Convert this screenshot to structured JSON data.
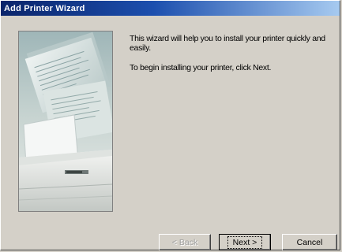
{
  "window": {
    "title": "Add Printer Wizard"
  },
  "content": {
    "intro_line": "This wizard will help you to install your printer quickly and easily.",
    "begin_line": "To begin installing your printer, click Next."
  },
  "buttons": {
    "back_label": "< Back",
    "next_label": "Next >",
    "cancel_label": "Cancel",
    "back_enabled": false,
    "default_button": "next"
  },
  "wizard_image": {
    "icon": "printer-wizard-illustration"
  },
  "colors": {
    "face": "#d4d0c8",
    "title_gradient_start": "#0a246a",
    "title_gradient_end": "#a6caf0",
    "title_text": "#ffffff",
    "disabled_text": "#a0a0a0"
  }
}
